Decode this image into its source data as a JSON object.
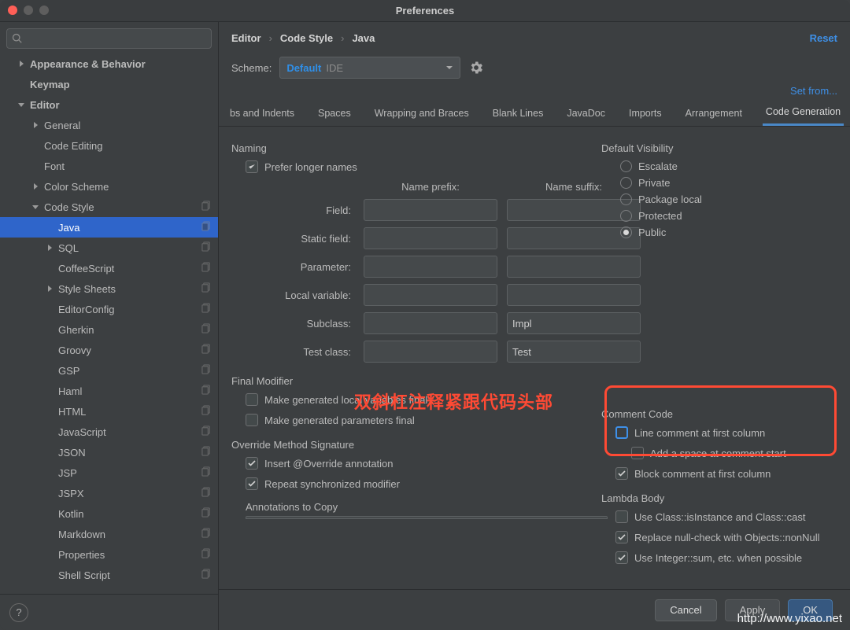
{
  "window": {
    "title": "Preferences"
  },
  "search": {
    "placeholder": ""
  },
  "sidebar": {
    "items": [
      {
        "label": "Appearance & Behavior",
        "depth": 0,
        "bold": true,
        "caret": "right"
      },
      {
        "label": "Keymap",
        "depth": 0,
        "bold": true
      },
      {
        "label": "Editor",
        "depth": 0,
        "bold": true,
        "caret": "down"
      },
      {
        "label": "General",
        "depth": 1,
        "caret": "right"
      },
      {
        "label": "Code Editing",
        "depth": 1
      },
      {
        "label": "Font",
        "depth": 1
      },
      {
        "label": "Color Scheme",
        "depth": 1,
        "caret": "right"
      },
      {
        "label": "Code Style",
        "depth": 1,
        "caret": "down",
        "copy": true
      },
      {
        "label": "Java",
        "depth": 2,
        "selected": true,
        "copy": true
      },
      {
        "label": "SQL",
        "depth": 2,
        "caret": "right",
        "copy": true
      },
      {
        "label": "CoffeeScript",
        "depth": 2,
        "copy": true
      },
      {
        "label": "Style Sheets",
        "depth": 2,
        "caret": "right",
        "copy": true
      },
      {
        "label": "EditorConfig",
        "depth": 2,
        "copy": true
      },
      {
        "label": "Gherkin",
        "depth": 2,
        "copy": true
      },
      {
        "label": "Groovy",
        "depth": 2,
        "copy": true
      },
      {
        "label": "GSP",
        "depth": 2,
        "copy": true
      },
      {
        "label": "Haml",
        "depth": 2,
        "copy": true
      },
      {
        "label": "HTML",
        "depth": 2,
        "copy": true
      },
      {
        "label": "JavaScript",
        "depth": 2,
        "copy": true
      },
      {
        "label": "JSON",
        "depth": 2,
        "copy": true
      },
      {
        "label": "JSP",
        "depth": 2,
        "copy": true
      },
      {
        "label": "JSPX",
        "depth": 2,
        "copy": true
      },
      {
        "label": "Kotlin",
        "depth": 2,
        "copy": true
      },
      {
        "label": "Markdown",
        "depth": 2,
        "copy": true
      },
      {
        "label": "Properties",
        "depth": 2,
        "copy": true
      },
      {
        "label": "Shell Script",
        "depth": 2,
        "copy": true
      }
    ]
  },
  "breadcrumb": {
    "a": "Editor",
    "b": "Code Style",
    "c": "Java"
  },
  "links": {
    "reset": "Reset",
    "setfrom": "Set from..."
  },
  "scheme": {
    "label": "Scheme:",
    "name": "Default",
    "hint": "IDE"
  },
  "tabs": [
    "bs and Indents",
    "Spaces",
    "Wrapping and Braces",
    "Blank Lines",
    "JavaDoc",
    "Imports",
    "Arrangement",
    "Code Generation"
  ],
  "active_tab_index": 7,
  "naming": {
    "title": "Naming",
    "prefer_longer": "Prefer longer names",
    "headers": {
      "prefix": "Name prefix:",
      "suffix": "Name suffix:"
    },
    "rows": [
      {
        "label": "Field:",
        "prefix": "",
        "suffix": ""
      },
      {
        "label": "Static field:",
        "prefix": "",
        "suffix": ""
      },
      {
        "label": "Parameter:",
        "prefix": "",
        "suffix": ""
      },
      {
        "label": "Local variable:",
        "prefix": "",
        "suffix": ""
      },
      {
        "label": "Subclass:",
        "prefix": "",
        "suffix": "Impl"
      },
      {
        "label": "Test class:",
        "prefix": "",
        "suffix": "Test"
      }
    ]
  },
  "visibility": {
    "title": "Default Visibility",
    "options": [
      "Escalate",
      "Private",
      "Package local",
      "Protected",
      "Public"
    ],
    "selected": "Public"
  },
  "final": {
    "title": "Final Modifier",
    "opts": [
      {
        "label": "Make generated local variables final",
        "checked": false
      },
      {
        "label": "Make generated parameters final",
        "checked": false
      }
    ]
  },
  "comment": {
    "title": "Comment Code",
    "opts": [
      {
        "label": "Line comment at first column",
        "checked": false,
        "style": "blue"
      },
      {
        "label": "Add a space at comment start",
        "checked": false,
        "style": "grey"
      },
      {
        "label": "Block comment at first column",
        "checked": true,
        "style": "normal"
      }
    ]
  },
  "override": {
    "title": "Override Method Signature",
    "opts": [
      {
        "label": "Insert @Override annotation",
        "checked": true
      },
      {
        "label": "Repeat synchronized modifier",
        "checked": true
      }
    ],
    "annots_title": "Annotations to Copy"
  },
  "lambda": {
    "title": "Lambda Body",
    "opts": [
      {
        "label": "Use Class::isInstance and Class::cast",
        "checked": false
      },
      {
        "label": "Replace null-check with Objects::nonNull",
        "checked": true
      },
      {
        "label": "Use Integer::sum, etc. when possible",
        "checked": true
      }
    ]
  },
  "annotation_text": "双斜杠注释紧跟代码头部",
  "buttons": {
    "cancel": "Cancel",
    "apply": "Apply",
    "ok": "OK"
  },
  "watermark": "http://www.yixao.net"
}
